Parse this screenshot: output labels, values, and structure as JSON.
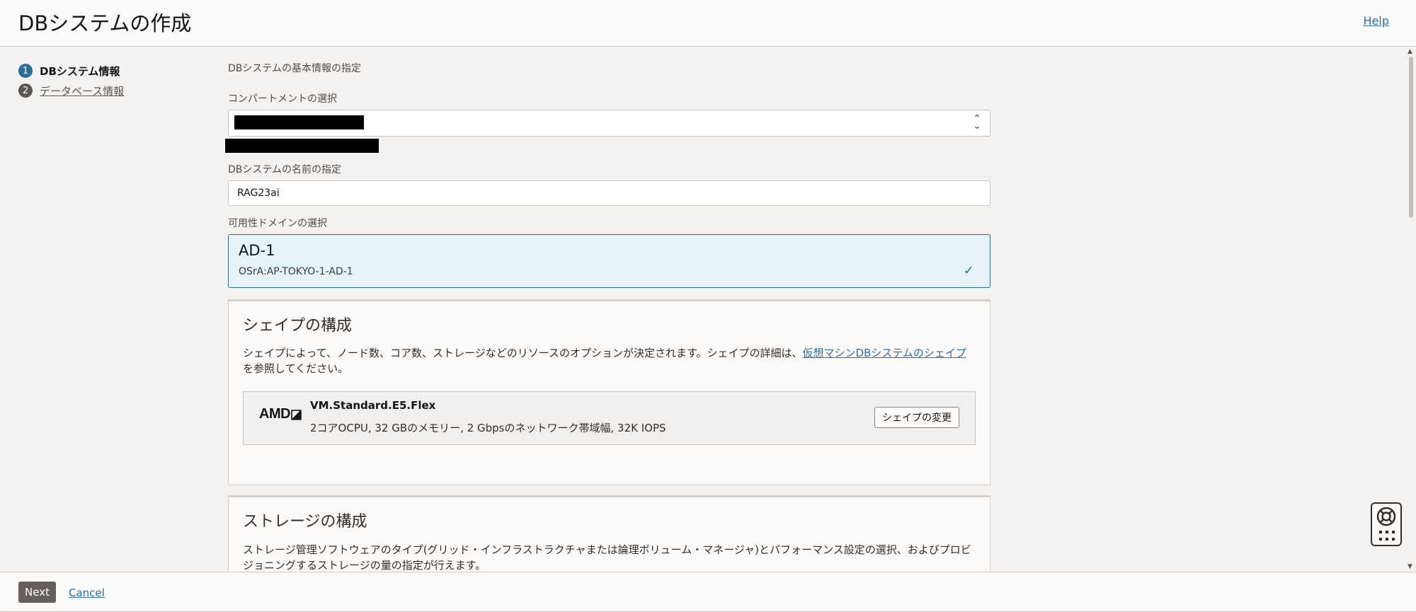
{
  "header": {
    "title": "DBシステムの作成",
    "help_label": "Help"
  },
  "steps": [
    {
      "number": "1",
      "label": "DBシステム情報",
      "state": "active"
    },
    {
      "number": "2",
      "label": "データベース情報",
      "state": "inactive"
    }
  ],
  "form": {
    "section_label": "DBシステムの基本情報の指定",
    "compartment_label": "コンパートメントの選択",
    "name_label": "DBシステムの名前の指定",
    "name_value": "RAG23ai",
    "availability_domain_label": "可用性ドメインの選択",
    "availability_domain": {
      "name": "AD-1",
      "id": "OSrA:AP-TOKYO-1-AD-1",
      "selected": true
    }
  },
  "shape_panel": {
    "title": "シェイプの構成",
    "desc_before_link": "シェイプによって、ノード数、コア数、ストレージなどのリソースのオプションが決定されます。シェイプの詳細は、",
    "desc_link": "仮想マシンDBシステムのシェイプ",
    "desc_after_link": "を参照してください。",
    "vendor_logo": "AMD",
    "shape_name": "VM.Standard.E5.Flex",
    "shape_spec": "2コアOCPU, 32 GBのメモリー, 2 Gbpsのネットワーク帯域幅, 32K IOPS",
    "change_button": "シェイプの変更"
  },
  "storage_panel": {
    "title": "ストレージの構成",
    "desc": "ストレージ管理ソフトウェアのタイプ(グリッド・インフラストラクチャまたは論理ボリューム・マネージャ)とパフォーマンス設定の選択、およびプロビジョニングするストレージの量の指定が行えます。"
  },
  "footer": {
    "next_label": "Next",
    "cancel_label": "Cancel"
  },
  "colors": {
    "accent": "#2a6e98",
    "link": "#2b6ea3",
    "selected_bg": "#e6f3f8",
    "next_button": "#665f5b"
  }
}
